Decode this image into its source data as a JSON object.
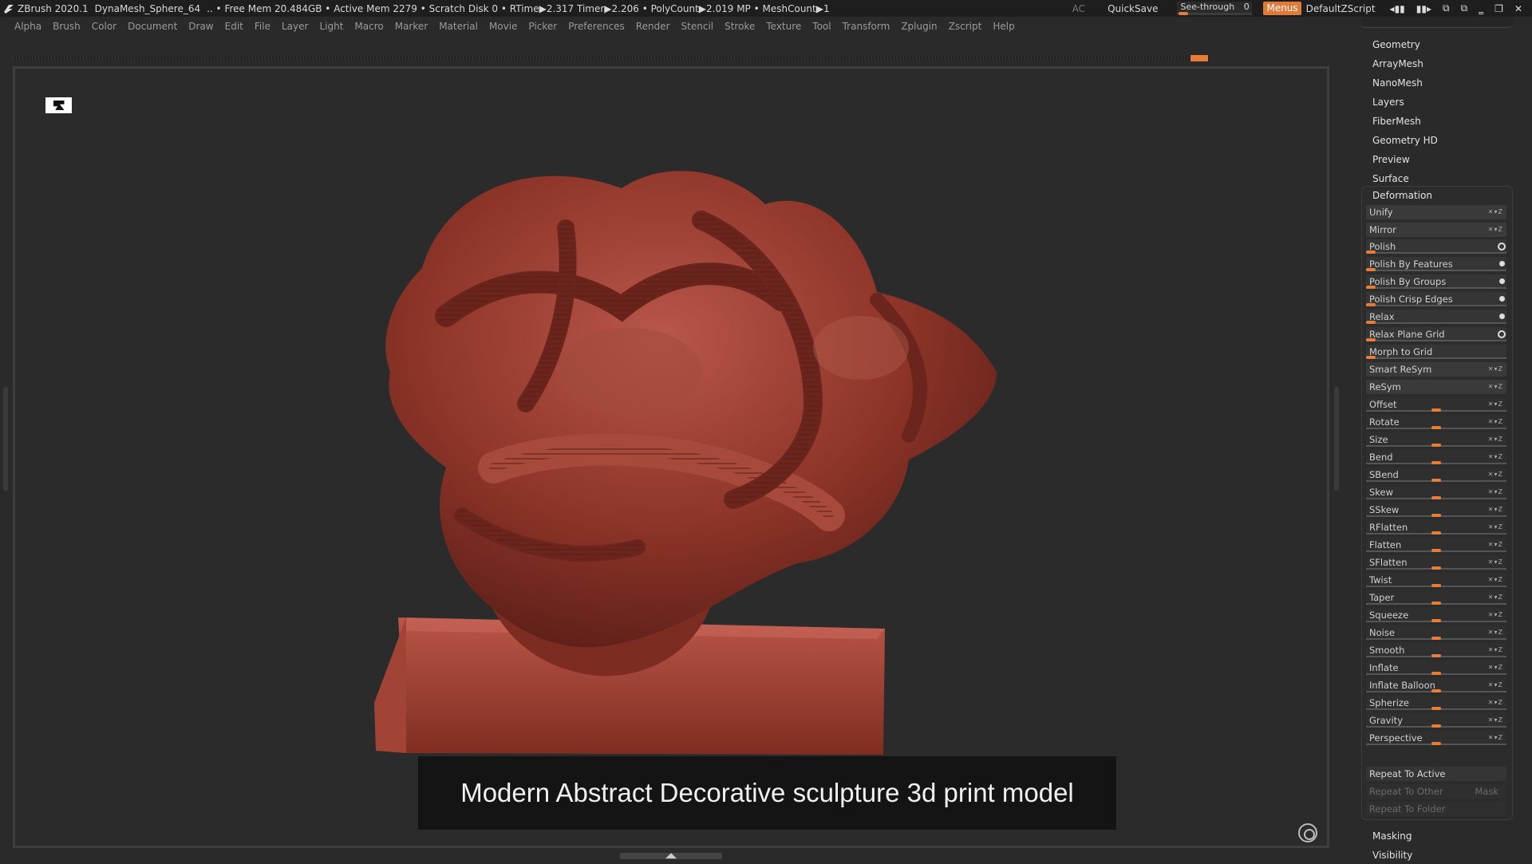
{
  "titlebar": {
    "app": "ZBrush 2020.1",
    "doc": "DynaMesh_Sphere_64",
    "stats": ".. • Free Mem 20.484GB • Active Mem 2279 • Scratch Disk 0 •  RTime▶2.317 Timer▶2.206 • PolyCount▶2.019 MP  • MeshCount▶1",
    "ac": "AC",
    "quicksave": "QuickSave",
    "seethrough_label": "See-through",
    "seethrough_value": "0",
    "menus": "Menus",
    "script": "DefaultZScript"
  },
  "menubar": [
    "Alpha",
    "Brush",
    "Color",
    "Document",
    "Draw",
    "Edit",
    "File",
    "Layer",
    "Light",
    "Macro",
    "Marker",
    "Material",
    "Movie",
    "Picker",
    "Preferences",
    "Render",
    "Stencil",
    "Stroke",
    "Texture",
    "Tool",
    "Transform",
    "Zplugin",
    "Zscript",
    "Help"
  ],
  "viewport": {
    "caption": "Modern Abstract Decorative sculpture 3d print model"
  },
  "panel": {
    "sections_top": [
      "Geometry",
      "ArrayMesh",
      "NanoMesh",
      "Layers",
      "FiberMesh",
      "Geometry HD",
      "Preview",
      "Surface"
    ],
    "deformation_title": "Deformation",
    "toggles": [
      "Unify",
      "Mirror"
    ],
    "polish_rows": [
      "Polish",
      "Polish By Features",
      "Polish By Groups",
      "Polish Crisp Edges",
      "Relax",
      "Relax Plane Grid",
      "Morph to Grid"
    ],
    "resym_rows": [
      "Smart ReSym",
      "ReSym"
    ],
    "slider_rows": [
      "Offset",
      "Rotate",
      "Size",
      "Bend",
      "SBend",
      "Skew",
      "SSkew",
      "RFlatten",
      "Flatten",
      "SFlatten",
      "Twist",
      "Taper",
      "Squeeze",
      "Noise",
      "Smooth",
      "Inflate",
      "Inflate Balloon",
      "Spherize",
      "Gravity",
      "Perspective"
    ],
    "repeat_active": "Repeat To Active",
    "repeat_other": "Repeat To Other",
    "mask": "Mask",
    "repeat_folder": "Repeat To Folder",
    "sections_bottom": [
      "Masking",
      "Visibility"
    ]
  },
  "colors": {
    "accent": "#e67e3a",
    "sculpture": "#9c3d2f",
    "background": "#2b2b2b"
  }
}
